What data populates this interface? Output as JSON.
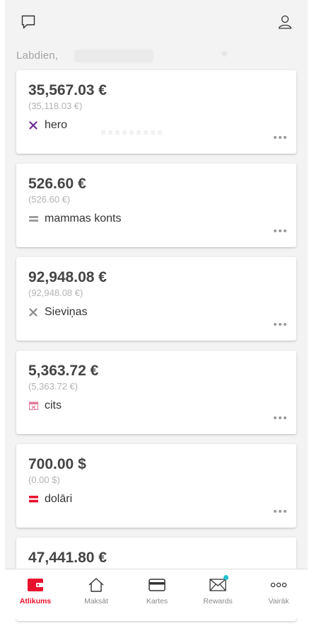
{
  "header": {
    "greeting": "Labdien,",
    "chat_icon": "chat-bubble-icon",
    "profile_icon": "user-profile-icon"
  },
  "accounts": [
    {
      "amount": "35,567.03 €",
      "sub_amount": "(35,118.03 €)",
      "name": "hero",
      "icon": "cross-icon",
      "icon_color": "#6a2c91"
    },
    {
      "amount": "526.60 €",
      "sub_amount": "(526.60 €)",
      "name": "mammas konts",
      "icon": "equals-icon",
      "icon_color": "#9e9e9e"
    },
    {
      "amount": "92,948.08 €",
      "sub_amount": "(92,948.08 €)",
      "name": "Sieviņas",
      "icon": "cross-icon",
      "icon_color": "#8a8a8a"
    },
    {
      "amount": "5,363.72 €",
      "sub_amount": "(5,363.72 €)",
      "name": "cits",
      "icon": "calendar-icon",
      "icon_color": "#e27a9a"
    },
    {
      "amount": "700.00 $",
      "sub_amount": "(0.00 $)",
      "name": "dolāri",
      "icon": "flag-icon",
      "icon_color": "#e8112d"
    },
    {
      "amount": "47,441.80 €"
    }
  ],
  "tabs": [
    {
      "label": "Atlikums",
      "icon": "wallet-icon",
      "active": true
    },
    {
      "label": "Maksāt",
      "icon": "home-icon"
    },
    {
      "label": "Kartes",
      "icon": "card-icon"
    },
    {
      "label": "Rewards",
      "icon": "rewards-envelope-icon",
      "badge": true
    },
    {
      "label": "Vairāk",
      "icon": "more-icon"
    }
  ],
  "colors": {
    "accent": "#e8112d",
    "badge": "#21c2cf",
    "background": "#f3f3f3"
  }
}
